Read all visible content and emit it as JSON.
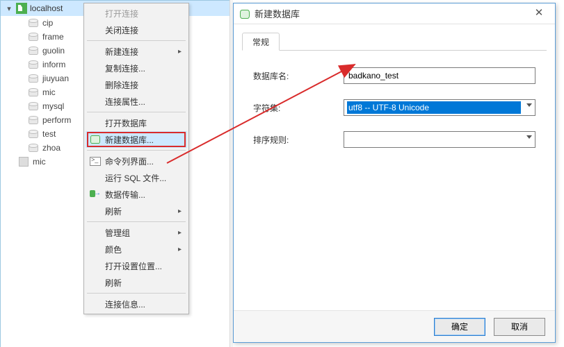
{
  "tree": {
    "connection_label": "localhost",
    "databases": [
      "cip",
      "frame",
      "guolin",
      "inform",
      "jiuyuan",
      "mic",
      "mysql",
      "perform",
      "test",
      "zhoa"
    ],
    "other_item": "mic"
  },
  "context_menu": {
    "open_conn": "打开连接",
    "close_conn": "关闭连接",
    "new_conn": "新建连接",
    "dup_conn": "复制连接...",
    "del_conn": "删除连接",
    "conn_props": "连接属性...",
    "open_db": "打开数据库",
    "new_db": "新建数据库...",
    "cmdline": "命令列界面...",
    "run_sql": "运行 SQL 文件...",
    "transfer": "数据传输...",
    "refresh": "刷新",
    "manage_group": "管理组",
    "color": "颜色",
    "open_settings_loc": "打开设置位置...",
    "refresh2": "刷新",
    "conn_info": "连接信息..."
  },
  "dialog": {
    "title": "新建数据库",
    "tab_general": "常规",
    "label_dbname": "数据库名:",
    "label_charset": "字符集:",
    "label_collation": "排序规则:",
    "dbname_value": "badkano_test",
    "charset_value": "utf8 -- UTF-8 Unicode",
    "collation_value": "",
    "ok": "确定",
    "cancel": "取消"
  }
}
